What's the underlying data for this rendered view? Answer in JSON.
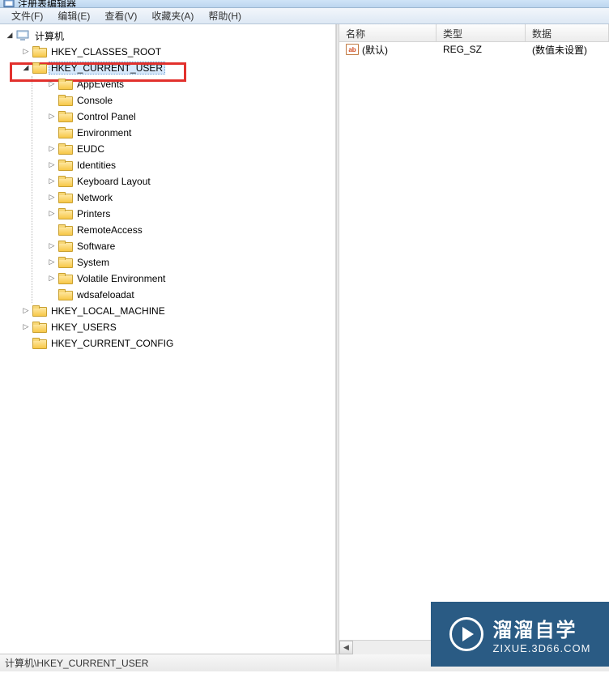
{
  "window": {
    "title": "注册表编辑器"
  },
  "menu": {
    "file": "文件(F)",
    "edit": "编辑(E)",
    "view": "查看(V)",
    "fav": "收藏夹(A)",
    "help": "帮助(H)"
  },
  "tree": {
    "root": "计算机",
    "hives": {
      "hkcr": "HKEY_CLASSES_ROOT",
      "hkcu": "HKEY_CURRENT_USER",
      "hklm": "HKEY_LOCAL_MACHINE",
      "hku": "HKEY_USERS",
      "hkcc": "HKEY_CURRENT_CONFIG"
    },
    "hkcu_children": [
      "AppEvents",
      "Console",
      "Control Panel",
      "Environment",
      "EUDC",
      "Identities",
      "Keyboard Layout",
      "Network",
      "Printers",
      "RemoteAccess",
      "Software",
      "System",
      "Volatile Environment",
      "wdsafeloadat"
    ]
  },
  "list": {
    "columns": {
      "name": "名称",
      "type": "类型",
      "data": "数据"
    },
    "rows": [
      {
        "name": "(默认)",
        "type": "REG_SZ",
        "data": "(数值未设置)"
      }
    ],
    "icon_label": "ab"
  },
  "statusbar": {
    "path": "计算机\\HKEY_CURRENT_USER"
  },
  "watermark": {
    "brand": "溜溜自学",
    "url": "ZIXUE.3D66.COM"
  }
}
